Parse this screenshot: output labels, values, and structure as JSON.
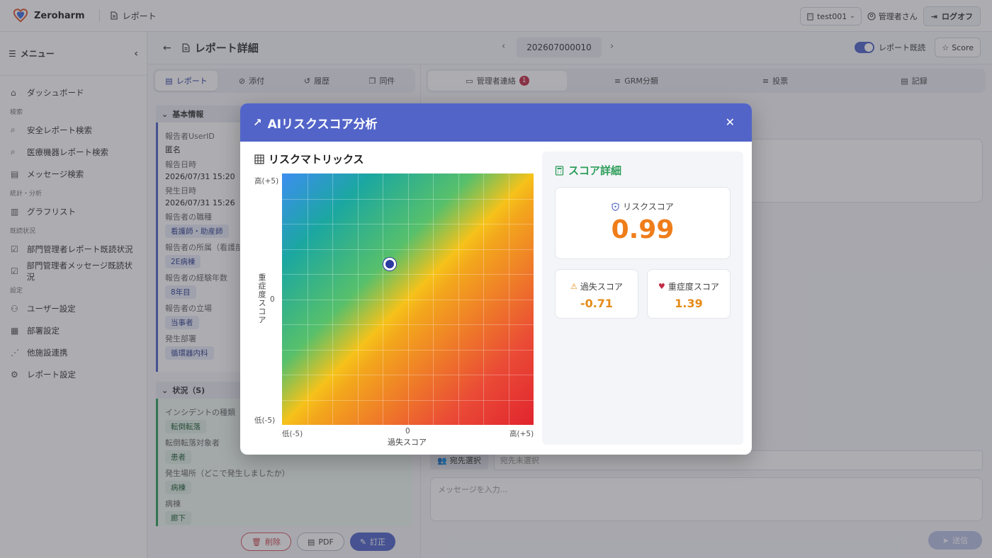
{
  "header": {
    "brand": "Zeroharm",
    "breadcrumb": "レポート",
    "tenant": "test001",
    "user": "管理者さん",
    "logout_label": "ログオフ"
  },
  "sidebar": {
    "menu_label": "メニュー",
    "items": [
      {
        "type": "item",
        "label": "ダッシュボード",
        "icon": "home-icon"
      },
      {
        "type": "section",
        "label": "検索"
      },
      {
        "type": "item",
        "label": "安全レポート検索",
        "icon": "search-icon"
      },
      {
        "type": "item",
        "label": "医療機器レポート検索",
        "icon": "search-icon"
      },
      {
        "type": "item",
        "label": "メッセージ検索",
        "icon": "message-icon"
      },
      {
        "type": "section",
        "label": "統計・分析"
      },
      {
        "type": "item",
        "label": "グラフリスト",
        "icon": "bar-chart-icon"
      },
      {
        "type": "section",
        "label": "既読状況"
      },
      {
        "type": "item",
        "label": "部門管理者レポート既読状況",
        "icon": "check-square-icon"
      },
      {
        "type": "item",
        "label": "部門管理者メッセージ既読状況",
        "icon": "check-square-icon"
      },
      {
        "type": "section",
        "label": "設定"
      },
      {
        "type": "item",
        "label": "ユーザー設定",
        "icon": "users-icon"
      },
      {
        "type": "item",
        "label": "部署設定",
        "icon": "building-icon"
      },
      {
        "type": "item",
        "label": "他施設連携",
        "icon": "share-icon"
      },
      {
        "type": "item",
        "label": "レポート設定",
        "icon": "gear-icon"
      }
    ]
  },
  "main": {
    "title": "レポート詳細",
    "report_number": "202607000010",
    "read_toggle_label": "レポート既読",
    "read_toggle_on": true,
    "score_button": "Score"
  },
  "left_tabs": [
    {
      "label": "レポート",
      "icon": "file-icon",
      "active": true
    },
    {
      "label": "添付",
      "icon": "paperclip-icon",
      "active": false
    },
    {
      "label": "履歴",
      "icon": "history-icon",
      "active": false
    },
    {
      "label": "同件",
      "icon": "copy-icon",
      "active": false
    }
  ],
  "basic_info": {
    "title": "基本情報",
    "fields": [
      {
        "label": "報告者UserID",
        "value": "匿名",
        "chip": false
      },
      {
        "label": "報告日時",
        "value": "2026/07/31 15:20",
        "chip": false
      },
      {
        "label": "発生日時",
        "value": "2026/07/31 15:26",
        "chip": false
      },
      {
        "label": "報告者の職種",
        "value": "看護師・助産師",
        "chip": true
      },
      {
        "label": "報告者の所属（看護部",
        "value": "2E病棟",
        "chip": true
      },
      {
        "label": "報告者の経験年数",
        "value": "8年目",
        "chip": true
      },
      {
        "label": "報告者の立場",
        "value": "当事者",
        "chip": true
      },
      {
        "label": "発生部署",
        "value": "循環器内科",
        "chip": true
      }
    ]
  },
  "situation": {
    "title": "状況（S)",
    "fields": [
      {
        "label": "インシデントの種類",
        "value": "転倒転落"
      },
      {
        "label": "転倒転落対象者",
        "value": "患者"
      },
      {
        "label": "発生場所（どこで発生しましたか）",
        "value": "病棟"
      },
      {
        "label": "病棟",
        "value": "廊下"
      }
    ]
  },
  "actions": {
    "delete": "削除",
    "pdf": "PDF",
    "fix": "訂正"
  },
  "right_tabs": [
    {
      "label": "管理者連絡",
      "icon": "chat-icon",
      "badge": "1",
      "active": true
    },
    {
      "label": "GRM分類",
      "icon": "list-icon",
      "badge": "",
      "active": false
    },
    {
      "label": "投票",
      "icon": "list-icon",
      "badge": "",
      "active": false
    },
    {
      "label": "記録",
      "icon": "doc-icon",
      "badge": "",
      "active": false
    }
  ],
  "compose": {
    "recipient_button": "宛先選択",
    "recipient_placeholder": "宛先未選択",
    "message_placeholder": "メッセージを入力...",
    "send_label": "送信"
  },
  "modal": {
    "title": "AIリスクスコア分析",
    "matrix_title": "リスクマトリックス",
    "y_axis_label": "重症度スコア",
    "x_axis_label": "過失スコア",
    "y_high": "高(+5)",
    "y_zero": "0",
    "y_low": "低(-5)",
    "x_low": "低(-5)",
    "x_zero": "0",
    "x_high": "高(+5)",
    "score_title": "スコア詳細",
    "risk_label": "リスクスコア",
    "risk_value": "0.99",
    "negligence_label": "過失スコア",
    "negligence_value": "-0.71",
    "severity_label": "重症度スコア",
    "severity_value": "1.39"
  },
  "chart_data": {
    "type": "scatter",
    "x_range": [
      -5,
      5
    ],
    "y_range": [
      -5,
      5
    ],
    "points": [
      {
        "x": -0.71,
        "y": 1.39
      }
    ],
    "grid": true,
    "xlabel": "過失スコア",
    "ylabel": "重症度スコア"
  },
  "colors": {
    "primary": "#5264c8",
    "score_orange": "#ef7d1a",
    "score_green": "#2e9e5b",
    "danger": "#c8404b"
  }
}
